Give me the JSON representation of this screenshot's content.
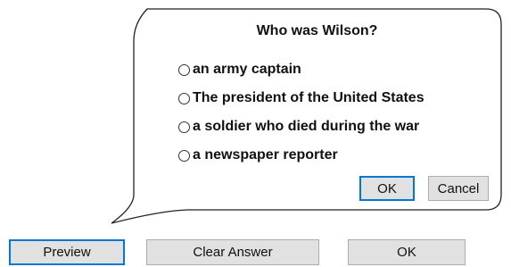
{
  "dialog": {
    "question": "Who was Wilson?",
    "options": [
      {
        "label": "an army captain",
        "selected": false
      },
      {
        "label": "The president of the United States",
        "selected": false
      },
      {
        "label": "a soldier who died during the war",
        "selected": false
      },
      {
        "label": "a newspaper reporter",
        "selected": false
      }
    ],
    "ok_label": "OK",
    "cancel_label": "Cancel"
  },
  "toolbar": {
    "preview_label": "Preview",
    "clear_label": "Clear Answer",
    "ok_label": "OK"
  },
  "colors": {
    "button_face": "#e1e1e1",
    "button_border": "#adadad",
    "focus_border": "#0078d7",
    "bubble_stroke": "#222222"
  }
}
